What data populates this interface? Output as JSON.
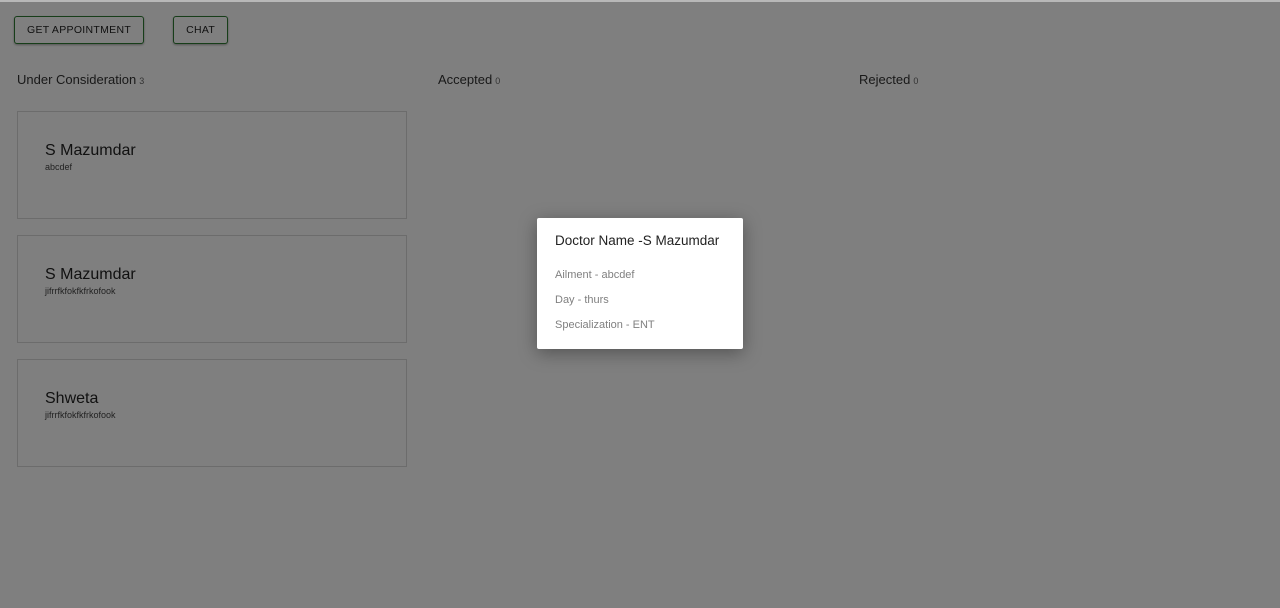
{
  "toolbar": {
    "get_appointment_label": "GET APPOINTMENT",
    "chat_label": "CHAT"
  },
  "columns": [
    {
      "title": "Under Consideration",
      "count": "3"
    },
    {
      "title": "Accepted",
      "count": "0"
    },
    {
      "title": "Rejected",
      "count": "0"
    }
  ],
  "cards": [
    {
      "name": "S Mazumdar",
      "ailment": "abcdef"
    },
    {
      "name": "S Mazumdar",
      "ailment": "jifrrfkfokfkfrkofook"
    },
    {
      "name": "Shweta",
      "ailment": "jifrrfkfokfkfrkofook"
    }
  ],
  "modal": {
    "title": "Doctor Name -S Mazumdar",
    "ailment": "Ailment - abcdef",
    "day": "Day - thurs",
    "specialization": "Specialization - ENT"
  },
  "colors": {
    "accent_border": "#2e7d32",
    "overlay": "rgba(0,0,0,0.5)"
  }
}
